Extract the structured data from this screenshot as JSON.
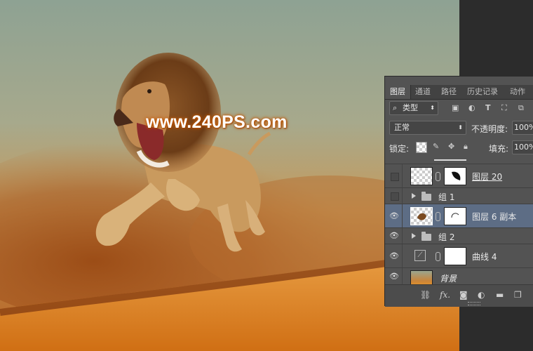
{
  "canvas": {
    "watermark": "www.240PS.com",
    "colors": {
      "sky": "#8fa594",
      "dust": "#a8571c",
      "sand": "#e08a2a"
    }
  },
  "layers_panel": {
    "tabs": [
      "图层",
      "通道",
      "路径",
      "历史记录",
      "动作"
    ],
    "active_tab": "图层",
    "filter_kind": "类型",
    "blend_mode": "正常",
    "opacity_label": "不透明度:",
    "opacity_value": "100%",
    "lock_label": "锁定:",
    "fill_label": "填充:",
    "fill_value": "100%",
    "layers": [
      {
        "name": "图层 20",
        "visible": false,
        "type": "layer-with-mask"
      },
      {
        "name": "组 1",
        "visible": false,
        "type": "group"
      },
      {
        "name": "图层 6 副本",
        "visible": true,
        "type": "layer-with-mask",
        "selected": true
      },
      {
        "name": "组 2",
        "visible": true,
        "type": "group"
      },
      {
        "name": "曲线 4",
        "visible": true,
        "type": "adjustment"
      },
      {
        "name": "背景",
        "visible": true,
        "type": "background"
      }
    ],
    "bottom_icons": [
      "link-icon",
      "fx-icon",
      "add-mask-icon",
      "adjustment-icon",
      "new-group-icon",
      "new-layer-icon"
    ],
    "fx_label": "fx."
  }
}
